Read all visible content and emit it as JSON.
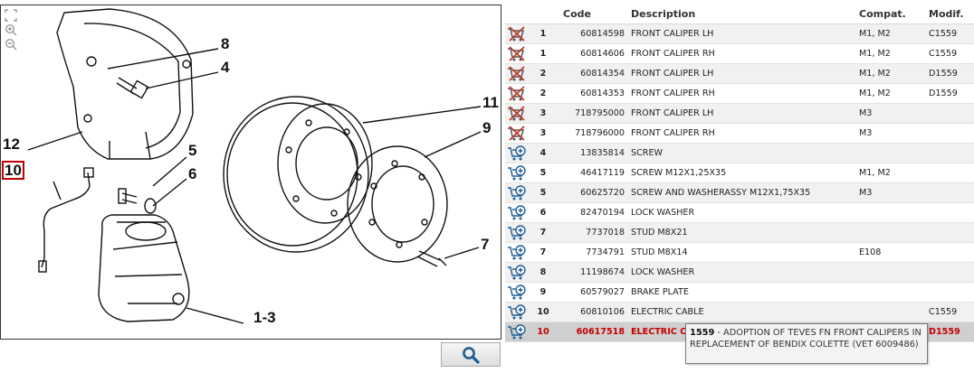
{
  "diagram": {
    "callouts": [
      {
        "label": "8"
      },
      {
        "label": "4"
      },
      {
        "label": "11"
      },
      {
        "label": "9"
      },
      {
        "label": "12"
      },
      {
        "label": "5"
      },
      {
        "label": "10"
      },
      {
        "label": "6"
      },
      {
        "label": "7"
      },
      {
        "label": "1-3"
      }
    ],
    "icons": [
      "fit-to-window-icon",
      "zoom-in-icon",
      "zoom-out-icon"
    ]
  },
  "search_button": {
    "icon": "magnifier-icon",
    "color": "#1f5f95"
  },
  "table": {
    "headers": {
      "code": "Code",
      "description": "Description",
      "compat": "Compat.",
      "modif": "Modif."
    },
    "rows": [
      {
        "ref": "1",
        "code": "60814598",
        "description": "FRONT CALIPER LH",
        "compat": "M1, M2",
        "modif": "C1559",
        "icon": "cart-remove-icon"
      },
      {
        "ref": "1",
        "code": "60814606",
        "description": "FRONT CALIPER RH",
        "compat": "M1, M2",
        "modif": "C1559",
        "icon": "cart-remove-icon"
      },
      {
        "ref": "2",
        "code": "60814354",
        "description": "FRONT CALIPER LH",
        "compat": "M1, M2",
        "modif": "D1559",
        "icon": "cart-remove-icon"
      },
      {
        "ref": "2",
        "code": "60814353",
        "description": "FRONT CALIPER RH",
        "compat": "M1, M2",
        "modif": "D1559",
        "icon": "cart-remove-icon"
      },
      {
        "ref": "3",
        "code": "718795000",
        "description": "FRONT CALIPER LH",
        "compat": "M3",
        "modif": "",
        "icon": "cart-remove-icon"
      },
      {
        "ref": "3",
        "code": "718796000",
        "description": "FRONT CALIPER RH",
        "compat": "M3",
        "modif": "",
        "icon": "cart-remove-icon"
      },
      {
        "ref": "4",
        "code": "13835814",
        "description": "SCREW",
        "compat": "",
        "modif": "",
        "icon": "cart-add-icon"
      },
      {
        "ref": "5",
        "code": "46417119",
        "description": "SCREW M12X1,25X35",
        "compat": "M1, M2",
        "modif": "",
        "icon": "cart-add-icon"
      },
      {
        "ref": "5",
        "code": "60625720",
        "description": "SCREW AND WASHERASSY M12X1,75X35",
        "compat": "M3",
        "modif": "",
        "icon": "cart-add-icon"
      },
      {
        "ref": "6",
        "code": "82470194",
        "description": "LOCK WASHER",
        "compat": "",
        "modif": "",
        "icon": "cart-add-icon"
      },
      {
        "ref": "7",
        "code": "7737018",
        "description": "STUD M8X21",
        "compat": "",
        "modif": "",
        "icon": "cart-add-icon"
      },
      {
        "ref": "7",
        "code": "7734791",
        "description": "STUD M8X14",
        "compat": "E108",
        "modif": "",
        "icon": "cart-add-icon"
      },
      {
        "ref": "8",
        "code": "11198674",
        "description": "LOCK WASHER",
        "compat": "",
        "modif": "",
        "icon": "cart-add-icon"
      },
      {
        "ref": "9",
        "code": "60579027",
        "description": "BRAKE PLATE",
        "compat": "",
        "modif": "",
        "icon": "cart-add-icon"
      },
      {
        "ref": "10",
        "code": "60810106",
        "description": "ELECTRIC CABLE",
        "compat": "",
        "modif": "C1559",
        "icon": "cart-add-icon"
      },
      {
        "ref": "10",
        "code": "60617518",
        "description": "ELECTRIC C",
        "compat": "",
        "modif": "D1559",
        "icon": "cart-add-icon",
        "highlight": true
      }
    ]
  },
  "tooltip": {
    "code": "1559",
    "text": " - ADOPTION OF TEVES FN FRONT CALIPERS IN REPLACEMENT OF BENDIX COLETTE (VET 6009486)"
  },
  "colors": {
    "highlight_text": "#c40000",
    "cart_add": "#1f5f95",
    "cart_remove": "#c0392b"
  }
}
